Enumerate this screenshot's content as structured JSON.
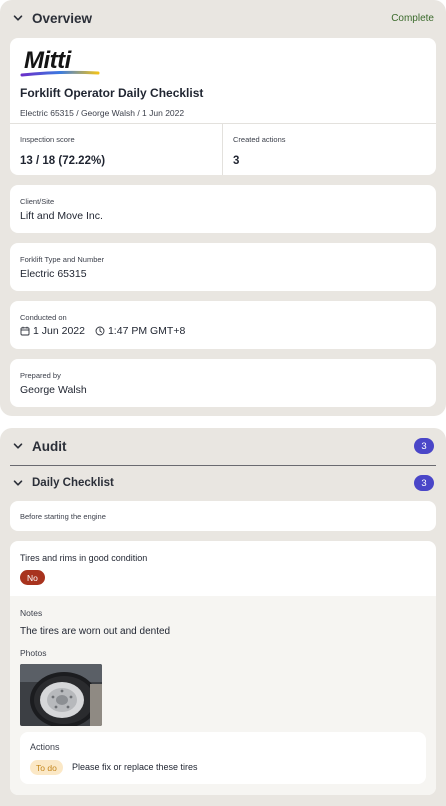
{
  "overview": {
    "section_title": "Overview",
    "status": "Complete",
    "logo_text": "Mitti",
    "title": "Forklift Operator Daily Checklist",
    "subtitle": "Electric 65315 / George Walsh / 1 Jun 2022",
    "inspection_score_label": "Inspection score",
    "inspection_score_value": "13 / 18 (72.22%)",
    "created_actions_label": "Created actions",
    "created_actions_value": "3",
    "client_site_label": "Client/Site",
    "client_site_value": "Lift and Move Inc.",
    "forklift_label": "Forklift Type and Number",
    "forklift_value": "Electric 65315",
    "conducted_label": "Conducted on",
    "conducted_date": "1 Jun 2022",
    "conducted_time": "1:47 PM GMT+8",
    "prepared_label": "Prepared by",
    "prepared_value": "George Walsh"
  },
  "audit": {
    "section_title": "Audit",
    "count": "3",
    "subsection_title": "Daily Checklist",
    "subsection_count": "3",
    "group_label": "Before starting the engine",
    "question": "Tires and rims in good condition",
    "answer": "No",
    "notes_label": "Notes",
    "notes_value": "The tires are worn out and dented",
    "photos_label": "Photos",
    "actions_label": "Actions",
    "action_status": "To do",
    "action_text": "Please fix or replace these tires"
  },
  "colors": {
    "panel_bg": "#e9e6e1",
    "complete_green": "#3b6a2c",
    "badge_purple": "#4a46c8",
    "no_red": "#a8331e",
    "todo_bg": "#fbe8c6",
    "todo_text": "#c4861c"
  },
  "icons": [
    "chevron-down-icon",
    "calendar-icon",
    "clock-icon"
  ]
}
